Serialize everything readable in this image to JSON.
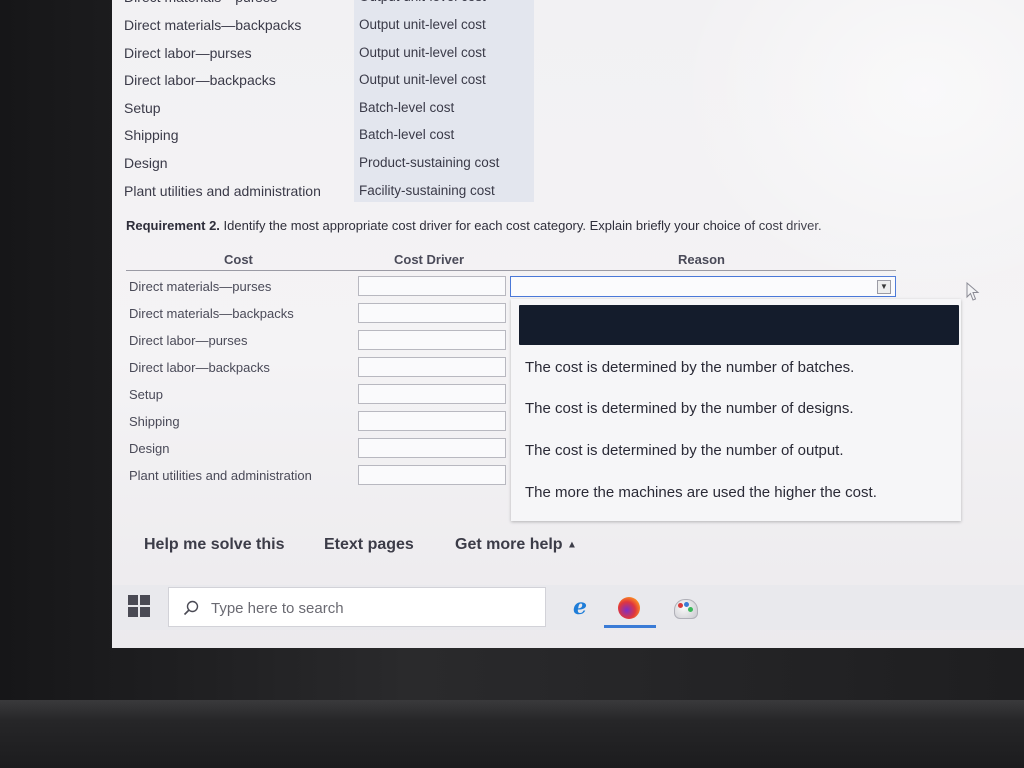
{
  "cost_hierarchy_table": {
    "rows": [
      {
        "cost": "Direct materials—backpacks",
        "category": "Output unit-level cost"
      },
      {
        "cost": "Direct labor—purses",
        "category": "Output unit-level cost"
      },
      {
        "cost": "Direct labor—backpacks",
        "category": "Output unit-level cost"
      },
      {
        "cost": "Setup",
        "category": "Batch-level cost"
      },
      {
        "cost": "Shipping",
        "category": "Batch-level cost"
      },
      {
        "cost": "Design",
        "category": "Product-sustaining cost"
      },
      {
        "cost": "Plant utilities and administration",
        "category": "Facility-sustaining cost"
      }
    ]
  },
  "requirement": {
    "label": "Requirement 2.",
    "text": " Identify the most appropriate cost driver for each cost category. Explain briefly your choice of cost driver."
  },
  "driver_table": {
    "headers": {
      "cost": "Cost",
      "driver": "Cost Driver",
      "reason": "Reason"
    },
    "rows": [
      {
        "cost": "Direct materials—purses",
        "driver": ""
      },
      {
        "cost": "Direct materials—backpacks",
        "driver": ""
      },
      {
        "cost": "Direct labor—purses",
        "driver": ""
      },
      {
        "cost": "Direct labor—backpacks",
        "driver": ""
      },
      {
        "cost": "Setup",
        "driver": ""
      },
      {
        "cost": "Shipping",
        "driver": ""
      },
      {
        "cost": "Design",
        "driver": ""
      },
      {
        "cost": "Plant utilities and administration",
        "driver": ""
      }
    ],
    "reason_select": {
      "selected": "",
      "arrow": "▼",
      "options": [
        "",
        "The cost is determined by the number of batches.",
        "The cost is determined by the number of designs.",
        "The cost is determined by the number of output.",
        "The more the machines are used the higher the cost."
      ]
    }
  },
  "help_links": {
    "help_me_solve": "Help me solve this",
    "etext": "Etext pages",
    "get_more_help": "Get more help",
    "caret": "▲"
  },
  "taskbar": {
    "search_placeholder": "Type here to search",
    "apps": [
      "start-menu",
      "internet-explorer",
      "firefox",
      "paint"
    ]
  },
  "colors": {
    "select_border": "#4a78d8",
    "highlight": "#141c2c",
    "category_bg": "#e3e6ee",
    "taskbar_active": "#3a7bd6"
  }
}
